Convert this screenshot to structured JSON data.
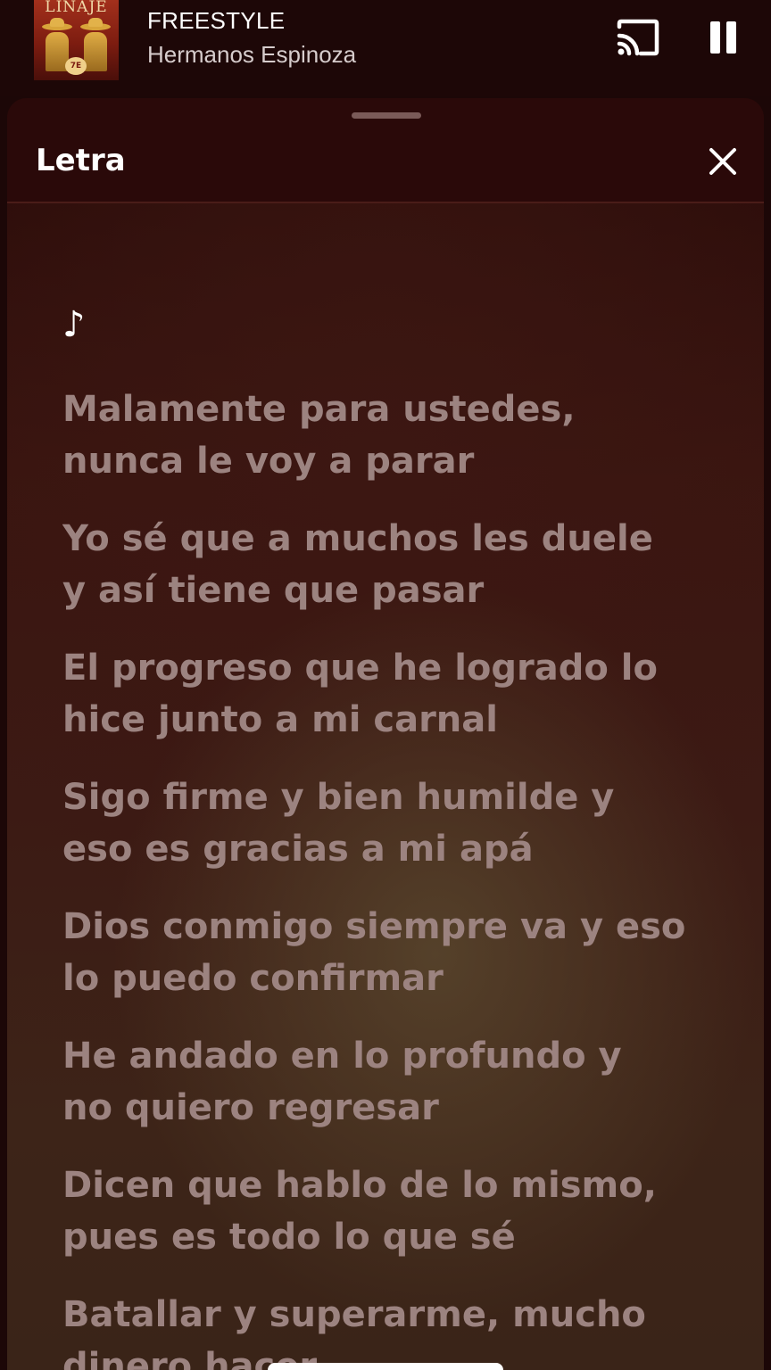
{
  "now_playing": {
    "album_art_text": "LINAJE",
    "album_badge_text": "7E",
    "title": "FREESTYLE",
    "artist": "Hermanos Espinoza"
  },
  "controls": {
    "cast_icon": "cast-icon",
    "pause_icon": "pause-icon"
  },
  "sheet": {
    "title": "Letra",
    "close_icon": "close-icon",
    "note_symbol": "♪"
  },
  "lyrics": [
    {
      "line1": "Malamente para ustedes,",
      "line2": "nunca le voy a parar"
    },
    {
      "line1": "Yo sé que a muchos les duele",
      "line2": "y así tiene que pasar"
    },
    {
      "line1": "El progreso que he logrado lo",
      "line2": "hice junto a mi carnal"
    },
    {
      "line1": "Sigo firme y bien humilde y",
      "line2": "eso es gracias a mi apá"
    },
    {
      "line1": "Dios conmigo siempre va y eso",
      "line2": "lo puedo confirmar"
    },
    {
      "line1": "He andado en lo profundo y",
      "line2": "no quiero regresar"
    },
    {
      "line1": "Dicen que hablo de lo mismo,",
      "line2": "pues es todo lo que sé"
    },
    {
      "line1": "Batallar y superarme, mucho",
      "line2": "dinero hacer"
    }
  ],
  "colors": {
    "background": "#1c0707",
    "sheet_header": "#2a0909",
    "lyric_text": "#9c8380",
    "title_text": "#ffffff"
  }
}
